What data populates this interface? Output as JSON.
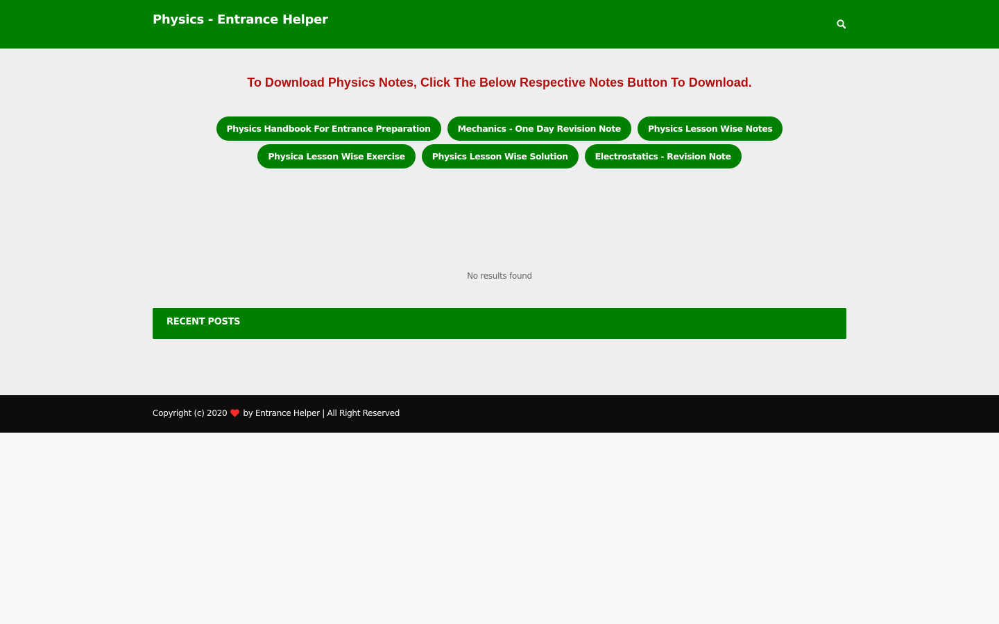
{
  "header": {
    "site_title": "Physics - Entrance Helper",
    "search_icon": "search-icon"
  },
  "main": {
    "notice": "To Download Physics Notes, Click The Below Respective Notes Button To Download.",
    "buttons_row1": [
      "Physics Handbook For Entrance Preparation",
      "Mechanics - One Day Revision Note",
      "Physics Lesson Wise Notes"
    ],
    "buttons_row2": [
      "Physica Lesson Wise Exercise",
      "Physics Lesson Wise Solution",
      "Electrostatics - Revision Note"
    ],
    "no_results": "No results found",
    "recent_posts_title": "RECENT POSTS"
  },
  "footer": {
    "copyright_prefix": "Copyright (c) 2020",
    "heart_icon": "heart-icon",
    "copyright_suffix": "by Entrance Helper | All Right Reserved"
  },
  "colors": {
    "brand_green": "#008000",
    "notice_red": "#b20f0f",
    "footer_bg": "#0d0d0d",
    "heart_red": "#ff2a2a"
  }
}
